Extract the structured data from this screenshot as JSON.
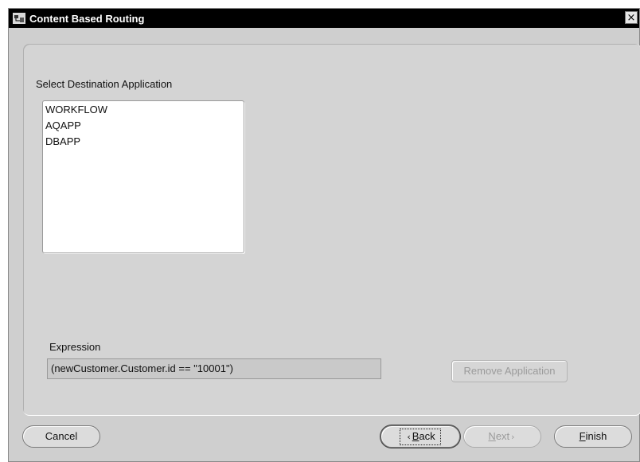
{
  "window": {
    "title": "Content Based Routing",
    "close_glyph": "×"
  },
  "main": {
    "select_label": "Select Destination Application",
    "applications": [
      "WORKFLOW",
      "AQAPP",
      "DBAPP"
    ],
    "expression_label": "Expression",
    "expression_value": "(newCustomer.Customer.id == \"10001\")",
    "remove_application_label": "Remove Application"
  },
  "footer": {
    "cancel_label": "Cancel",
    "back_label": "Back",
    "back_accel": "B",
    "back_rest": "ack",
    "next_accel": "N",
    "next_rest": "ext",
    "finish_accel": "F",
    "finish_rest": "inish"
  },
  "icons": {
    "window_icon": "app-icon",
    "back_arrow": "chevron-left-icon",
    "next_arrow": "chevron-right-icon"
  },
  "colors": {
    "titlebar": "#000000",
    "panel": "#d4d4d4",
    "disabled_text": "#9b9b9b"
  }
}
